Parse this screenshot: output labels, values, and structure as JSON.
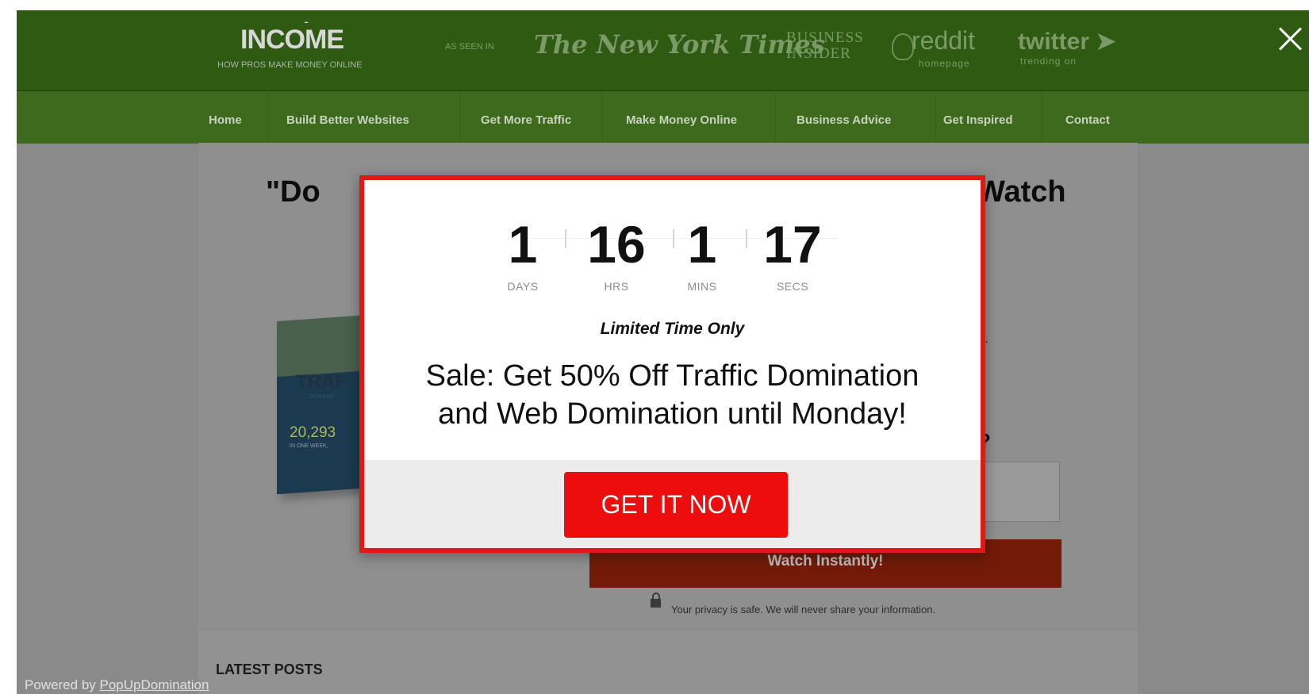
{
  "header": {
    "logo_title": "INCOME",
    "logo_tagline": "HOW PROS MAKE MONEY ONLINE",
    "as_seen_in": "AS SEEN IN",
    "press": {
      "nyt": "The New York Times",
      "bi_line1": "BUSINESS",
      "bi_line2": "INSIDER",
      "reddit": "reddit",
      "reddit_sub": "homepage",
      "twitter": "twitter",
      "twitter_sub": "trending on"
    }
  },
  "nav": {
    "items": [
      {
        "label": "Home"
      },
      {
        "label": "Build Better Websites"
      },
      {
        "label": "Get More Traffic"
      },
      {
        "label": "Make Money Online"
      },
      {
        "label": "Business Advice"
      },
      {
        "label": "Get Inspired"
      },
      {
        "label": "Contact"
      }
    ]
  },
  "page": {
    "heading_left": "\"Do",
    "heading_right": "Watch",
    "book": {
      "word": "TRAF",
      "small": "DOMINAT",
      "number": "20,293",
      "week": "IN ONE WEEK,"
    },
    "right_fragment": "s.",
    "right_question": "?",
    "watch_button": "Watch Instantly!",
    "privacy": "Your privacy is safe. We will never share your information.",
    "latest_posts": "LATEST POSTS",
    "powered_prefix": "Powered by ",
    "powered_link": "PopUpDomination"
  },
  "popup": {
    "countdown": {
      "days": "1",
      "hours": "16",
      "mins": "1",
      "secs": "17",
      "days_label": "DAYS",
      "hours_label": "HRS",
      "mins_label": "MINS",
      "secs_label": "SECS"
    },
    "limited": "Limited Time Only",
    "sale_line1": "Sale: Get 50% Off Traffic Domination",
    "sale_line2": "and Web Domination until Monday!",
    "cta": "GET IT NOW"
  },
  "colors": {
    "header_green": "#2f5a12",
    "nav_green": "#3d6a1c",
    "popup_border": "#e01a12",
    "cta_red": "#ee0d0d",
    "overlay_grey": "#8a8a8a"
  },
  "icons": {
    "close": "close-icon",
    "lock": "lock-icon",
    "reddit": "reddit-alien-icon",
    "twitter": "twitter-bird-icon"
  }
}
